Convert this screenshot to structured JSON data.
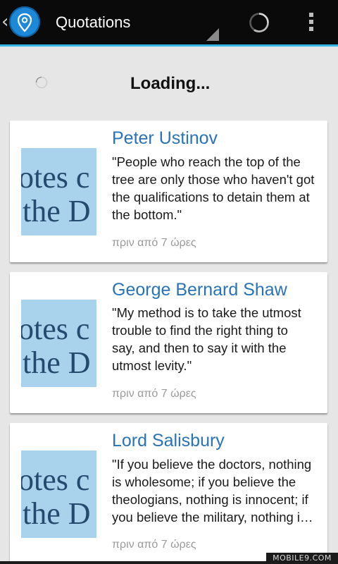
{
  "actionbar": {
    "title": "Quotations",
    "back_icon": "chevron-left-icon",
    "app_icon": "location-pin-icon",
    "refresh_icon": "progress-spinner-icon",
    "overflow_icon": "overflow-menu-icon",
    "accent_color": "#33b5e5"
  },
  "loading": {
    "text": "Loading..."
  },
  "thumbnail_text": {
    "line1": "otes c",
    "line2": "the D"
  },
  "quotes": [
    {
      "author": "Peter Ustinov",
      "lines": [
        "\"People who reach the top of the",
        "tree are only those who haven't got",
        "the qualifications to detain them at",
        "the bottom.\""
      ],
      "time": "πριν από 7 ώρες"
    },
    {
      "author": "George Bernard Shaw",
      "lines": [
        "\"My method is to take the utmost",
        "trouble to find the right thing to",
        "say, and then to say it with the",
        "utmost levity.\""
      ],
      "time": "πριν από 7 ώρες"
    },
    {
      "author": "Lord Salisbury",
      "lines": [
        "\"If you believe the doctors, nothing",
        "is wholesome; if you believe the",
        "theologians, nothing is innocent; if",
        "you believe the military, nothing i…"
      ],
      "time": "πριν από 7 ώρες"
    }
  ],
  "watermark": "MOBILE9.COM"
}
